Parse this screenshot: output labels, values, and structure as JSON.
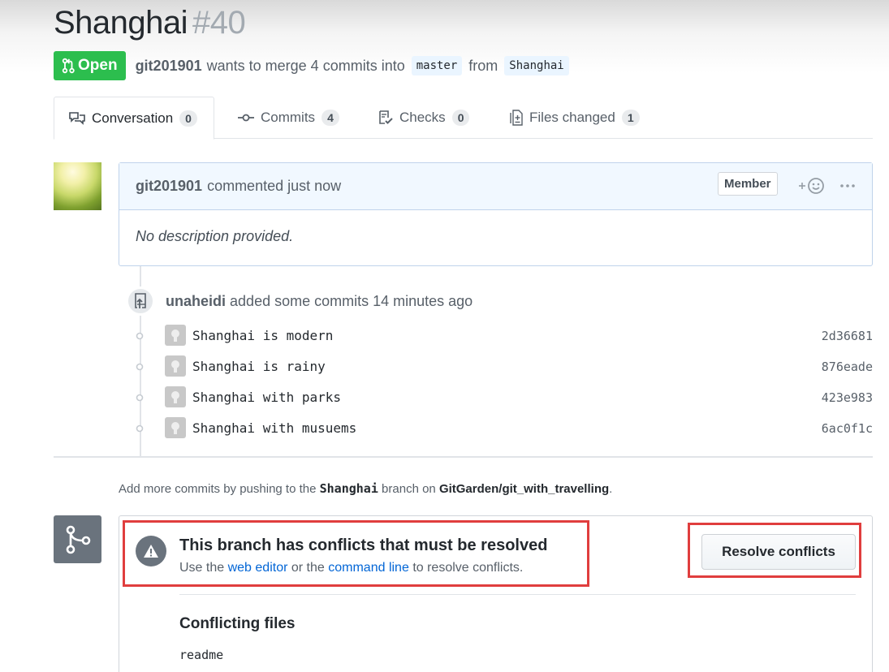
{
  "pr": {
    "title": "Shanghai",
    "number": "#40",
    "state": "Open",
    "author": "git201901",
    "merge_text": "wants to merge 4 commits into",
    "base_branch": "master",
    "from_text": "from",
    "head_branch": "Shanghai"
  },
  "tabs": [
    {
      "label": "Conversation",
      "count": "0",
      "icon": "comment-discussion-icon"
    },
    {
      "label": "Commits",
      "count": "4",
      "icon": "git-commit-icon"
    },
    {
      "label": "Checks",
      "count": "0",
      "icon": "checklist-icon"
    },
    {
      "label": "Files changed",
      "count": "1",
      "icon": "diff-icon"
    }
  ],
  "comment": {
    "author": "git201901",
    "action": "commented just now",
    "badge": "Member",
    "body": "No description provided."
  },
  "push_event": {
    "author": "unaheidi",
    "text": "added some commits 14 minutes ago"
  },
  "commits": [
    {
      "message": "Shanghai is modern",
      "sha": "2d36681"
    },
    {
      "message": "Shanghai is rainy",
      "sha": "876eade"
    },
    {
      "message": "Shanghai with parks",
      "sha": "423e983"
    },
    {
      "message": "Shanghai with musuems",
      "sha": "6ac0f1c"
    }
  ],
  "add_more": {
    "prefix": "Add more commits by pushing to the",
    "branch": "Shanghai",
    "middle": "branch on",
    "repo": "GitGarden/git_with_travelling",
    "suffix": "."
  },
  "merge": {
    "title": "This branch has conflicts that must be resolved",
    "desc_prefix": "Use the",
    "link1": "web editor",
    "desc_middle": "or the",
    "link2": "command line",
    "desc_suffix": "to resolve conflicts.",
    "resolve_button": "Resolve conflicts",
    "files_title": "Conflicting files",
    "files": [
      "readme"
    ]
  },
  "colors": {
    "open_green": "#2cbe4e",
    "link_blue": "#0366d6",
    "highlight_red": "#e03e3e"
  }
}
